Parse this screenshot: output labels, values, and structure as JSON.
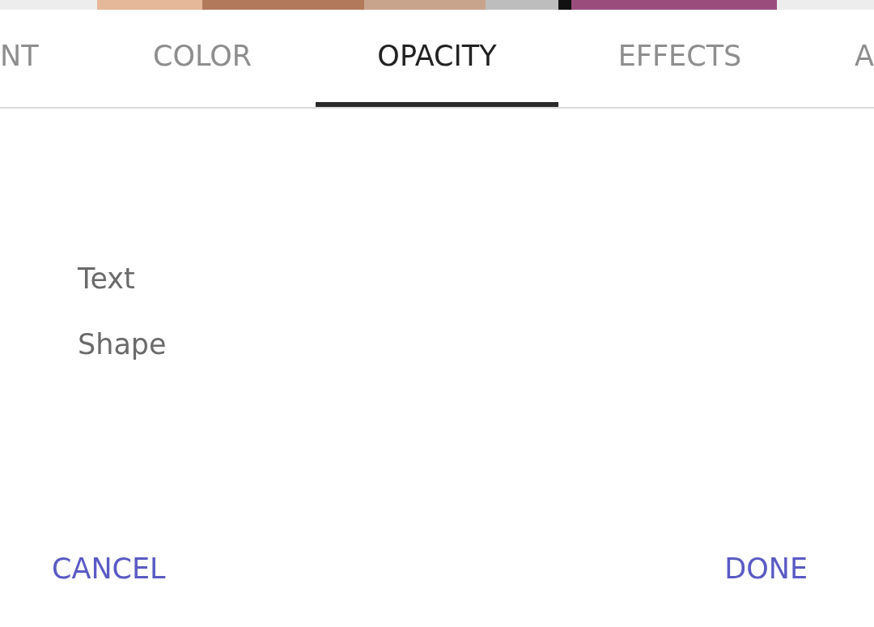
{
  "tabs": [
    {
      "label": "NT",
      "selected": false
    },
    {
      "label": "COLOR",
      "selected": false
    },
    {
      "label": "OPACITY",
      "selected": true
    },
    {
      "label": "EFFECTS",
      "selected": false
    },
    {
      "label": "A",
      "selected": false
    }
  ],
  "items": [
    "Text",
    "Shape"
  ],
  "buttons": {
    "cancel": "CANCEL",
    "done": "DONE"
  }
}
